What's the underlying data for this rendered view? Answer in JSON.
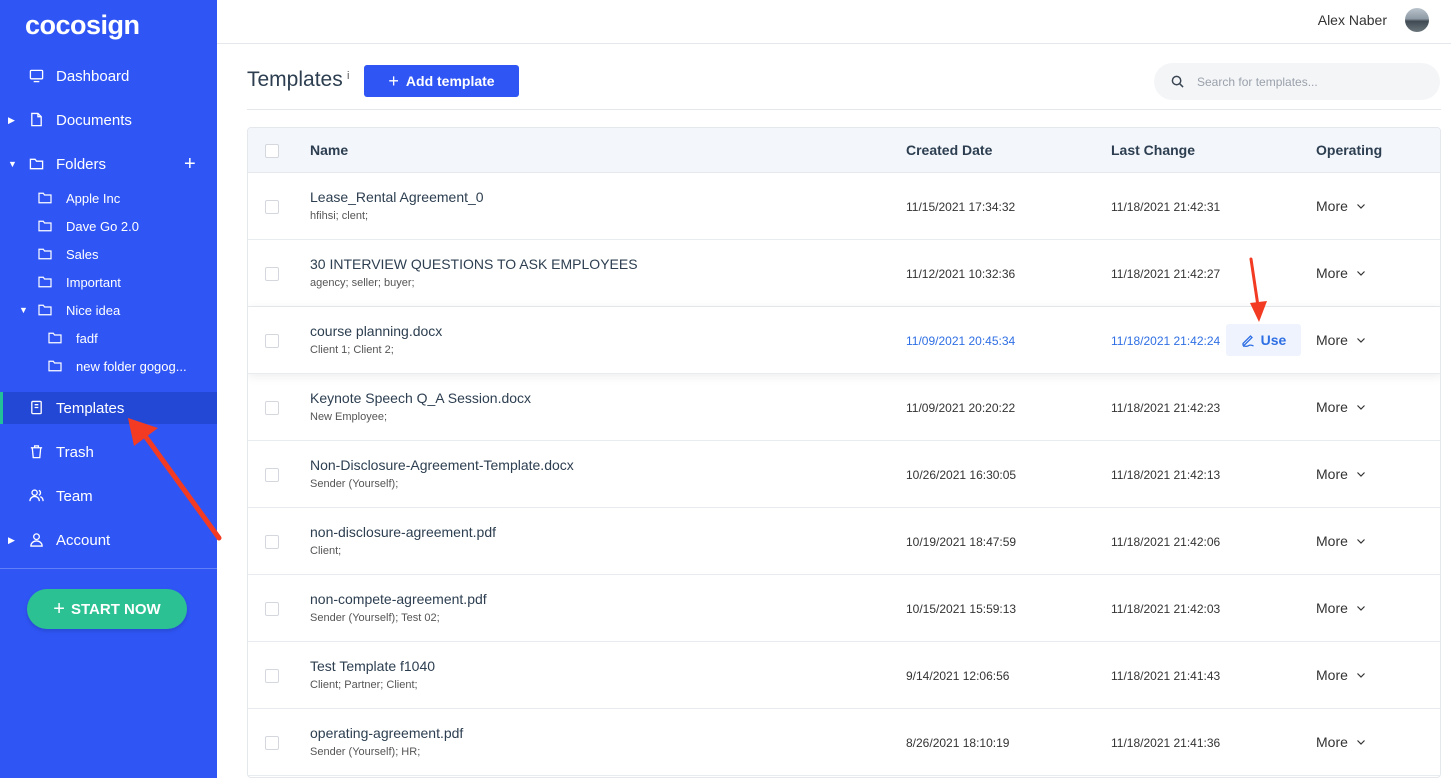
{
  "app": {
    "logo": "cocosign"
  },
  "sidebar": {
    "items": [
      {
        "label": "Dashboard",
        "icon": "monitor-icon"
      },
      {
        "label": "Documents",
        "icon": "document-icon"
      },
      {
        "label": "Folders",
        "icon": "folder-icon"
      },
      {
        "label": "Templates",
        "icon": "template-icon",
        "active": true
      },
      {
        "label": "Trash",
        "icon": "trash-icon"
      },
      {
        "label": "Team",
        "icon": "team-icon"
      },
      {
        "label": "Account",
        "icon": "user-icon"
      }
    ],
    "folders": [
      {
        "label": "Apple Inc"
      },
      {
        "label": "Dave Go 2.0"
      },
      {
        "label": "Sales"
      },
      {
        "label": "Important"
      },
      {
        "label": "Nice idea"
      },
      {
        "label": "fadf"
      },
      {
        "label": "new folder gogog..."
      }
    ],
    "start_label": "START NOW",
    "add_folder_symbol": "+"
  },
  "header": {
    "user_name": "Alex Naber"
  },
  "page": {
    "title": "Templates",
    "info_mark": "i",
    "add_button": "Add template",
    "search_placeholder": "Search for templates..."
  },
  "table": {
    "columns": [
      "Name",
      "Created Date",
      "Last Change",
      "Operating"
    ],
    "use_label": "Use",
    "more_label": "More",
    "rows": [
      {
        "name": "Lease_Rental Agreement_0",
        "tags": "hfihsi;   clent;",
        "created": "11/15/2021 17:34:32",
        "changed": "11/18/2021 21:42:31"
      },
      {
        "name": "30 INTERVIEW QUESTIONS TO ASK EMPLOYEES",
        "tags": "agency;   seller;   buyer;",
        "created": "11/12/2021 10:32:36",
        "changed": "11/18/2021 21:42:27"
      },
      {
        "name": "course planning.docx",
        "tags": "Client 1;   Client 2;",
        "created": "11/09/2021 20:45:34",
        "changed": "11/18/2021 21:42:24"
      },
      {
        "name": "Keynote Speech Q_A Session.docx",
        "tags": "New Employee;",
        "created": "11/09/2021 20:20:22",
        "changed": "11/18/2021 21:42:23"
      },
      {
        "name": "Non-Disclosure-Agreement-Template.docx",
        "tags": "Sender (Yourself);",
        "created": "10/26/2021 16:30:05",
        "changed": "11/18/2021 21:42:13"
      },
      {
        "name": "non-disclosure-agreement.pdf",
        "tags": "Client;",
        "created": "10/19/2021 18:47:59",
        "changed": "11/18/2021 21:42:06"
      },
      {
        "name": "non-compete-agreement.pdf",
        "tags": "Sender (Yourself);   Test 02;",
        "created": "10/15/2021 15:59:13",
        "changed": "11/18/2021 21:42:03"
      },
      {
        "name": "Test Template f1040",
        "tags": "Client;   Partner;   Client;",
        "created": "9/14/2021 12:06:56",
        "changed": "11/18/2021 21:41:43"
      },
      {
        "name": "operating-agreement.pdf",
        "tags": "Sender (Yourself);   HR;",
        "created": "8/26/2021 18:10:19",
        "changed": "11/18/2021 21:41:36"
      }
    ]
  },
  "colors": {
    "sidebar": "#2f55f5",
    "accent_green": "#2cc193",
    "link_blue": "#2f6fe4",
    "annotation_red": "#f23b22"
  }
}
